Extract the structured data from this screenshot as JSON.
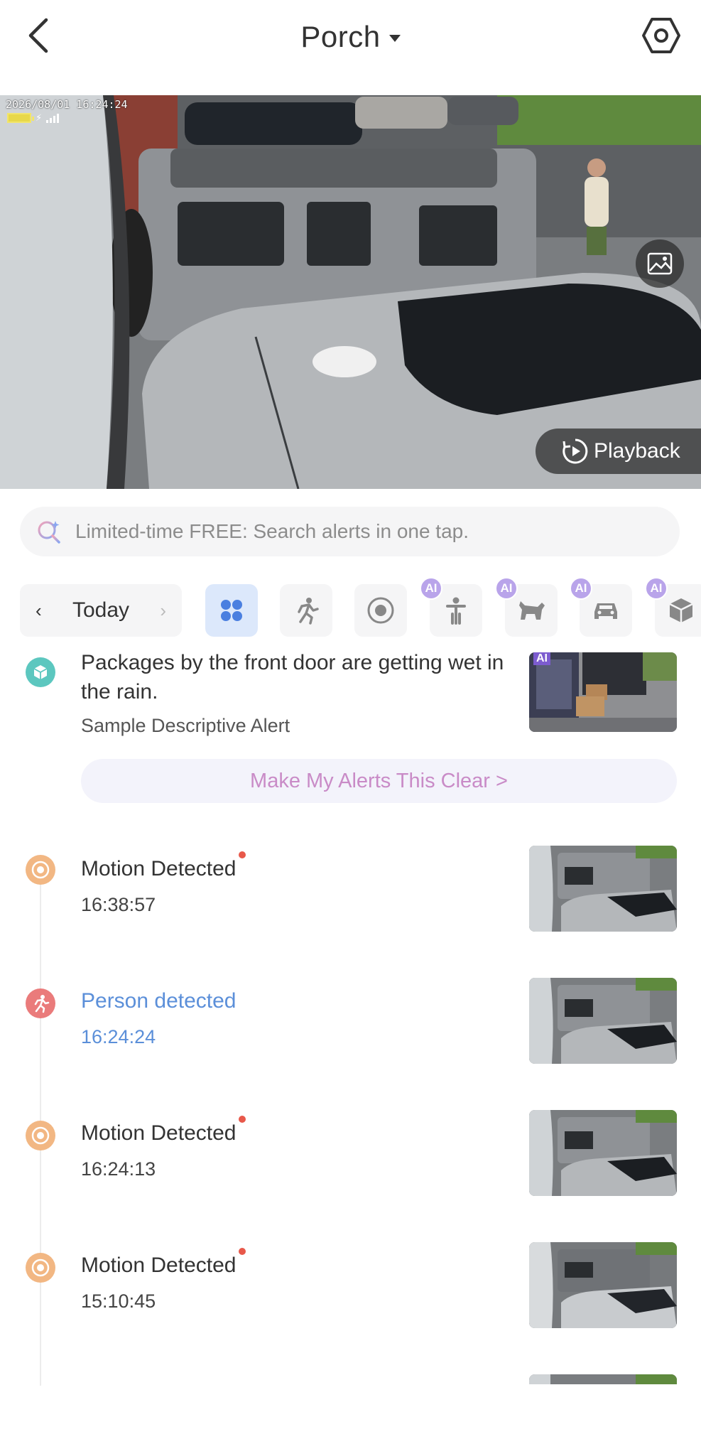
{
  "header": {
    "title": "Porch",
    "back_icon": "chevron-left-icon",
    "settings_icon": "hexagon-settings-icon"
  },
  "live_view": {
    "osd_timestamp": "2026/08/01 16:24:24",
    "playback_label": "Playback",
    "snapshot_icon": "image-snapshot-icon",
    "playback_icon": "replay-icon"
  },
  "search_banner": {
    "text": "Limited-time FREE: Search alerts in one tap.",
    "icon": "ai-search-icon"
  },
  "filters": {
    "date_label": "Today",
    "items": [
      {
        "name": "all",
        "icon": "grid-icon",
        "active": true,
        "ai": false
      },
      {
        "name": "person-motion",
        "icon": "running-person-icon",
        "active": false,
        "ai": false
      },
      {
        "name": "motion",
        "icon": "target-icon",
        "active": false,
        "ai": false
      },
      {
        "name": "human",
        "icon": "human-icon",
        "active": false,
        "ai": true,
        "badge": "AI"
      },
      {
        "name": "pet",
        "icon": "pet-icon",
        "active": false,
        "ai": true,
        "badge": "AI"
      },
      {
        "name": "vehicle",
        "icon": "car-icon",
        "active": false,
        "ai": true,
        "badge": "AI"
      },
      {
        "name": "package",
        "icon": "package-icon",
        "active": false,
        "ai": true,
        "badge": "AI"
      }
    ]
  },
  "sample_alert": {
    "text": "Packages by the front door are getting wet in the rain.",
    "subtitle": "Sample Descriptive Alert",
    "badge": "AI",
    "cta": "Make My Alerts This Clear >"
  },
  "events": [
    {
      "title": "Motion Detected",
      "time": "16:38:57",
      "type": "motion",
      "unread": true
    },
    {
      "title": "Person detected",
      "time": "16:24:24",
      "type": "person",
      "unread": false
    },
    {
      "title": "Motion Detected",
      "time": "16:24:13",
      "type": "motion",
      "unread": true
    },
    {
      "title": "Motion Detected",
      "time": "15:10:45",
      "type": "motion",
      "unread": true
    }
  ],
  "colors": {
    "accent_blue": "#5b8fd9",
    "motion_orange": "#f2b783",
    "person_red": "#ea7b7b",
    "package_teal": "#5cc7bf",
    "ai_purple": "#b9a4ea",
    "cta_pink": "#c98bc7"
  }
}
